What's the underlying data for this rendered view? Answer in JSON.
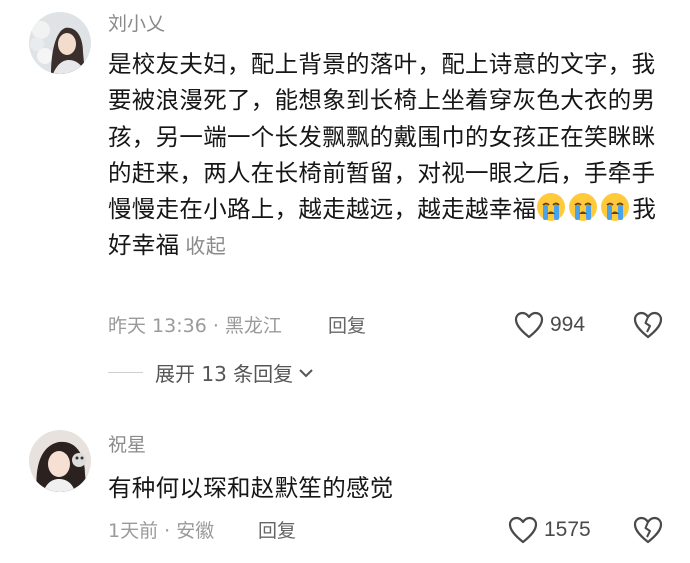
{
  "comments": [
    {
      "author": "刘小乂",
      "text": "是校友夫妇，配上背景的落叶，配上诗意的文字，我要被浪漫死了，能想象到长椅上坐着穿灰色大衣的男孩，另一端一个长发飘飘的戴围巾的女孩正在笑眯眯的赶来，两人在长椅前暂留，对视一眼之后，手牵手慢慢走在小路上，越走越远，越走越幸福",
      "emojis": [
        "crying-face",
        "crying-face",
        "crying-face"
      ],
      "text_after_emoji": "我好幸福",
      "collapse_label": "收起",
      "time": "昨天 13:36",
      "location": "黑龙江",
      "reply_label": "回复",
      "likes": "994",
      "expand_label": "展开 13 条回复"
    },
    {
      "author": "祝星",
      "text": "有种何以琛和赵默笙的感觉",
      "time": "1天前",
      "location": "安徽",
      "reply_label": "回复",
      "likes": "1575"
    }
  ]
}
